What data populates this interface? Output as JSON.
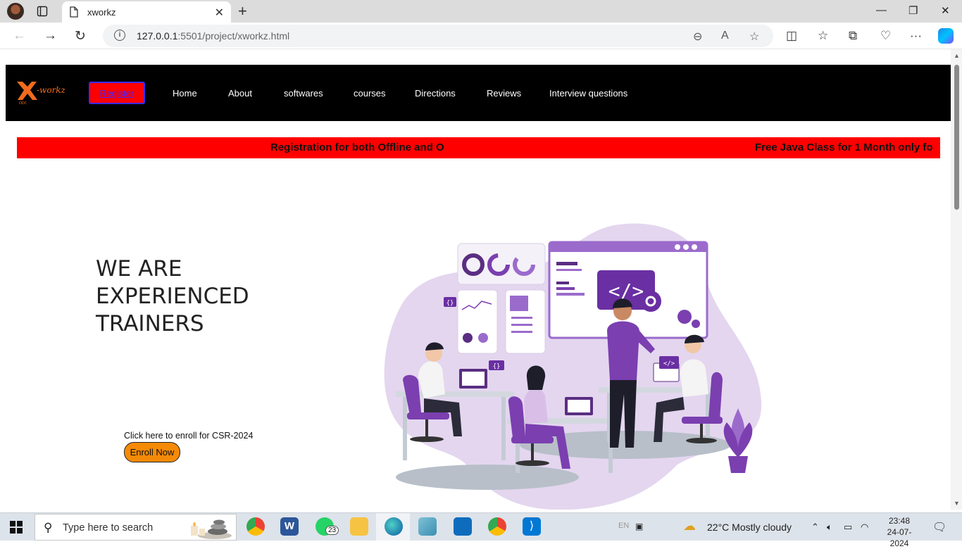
{
  "browser": {
    "tab_title": "xworkz",
    "url_host": "127.0.0.1",
    "url_rest": ":5501/project/xworkz.html"
  },
  "site": {
    "nav": {
      "register_label": "Register",
      "links": [
        "Home",
        "About",
        "softwares",
        "courses",
        "Directions",
        "Reviews",
        "Interview questions"
      ]
    },
    "marquee": {
      "item1": "Registration for both Offline and O",
      "item2": "Free Java Class for 1 Month only fo"
    },
    "hero": {
      "title_line1": "WE ARE",
      "title_line2": "EXPERIENCED",
      "title_line3": "TRAINERS",
      "enroll_text": "Click here to enroll for CSR-2024",
      "enroll_button": "Enroll Now"
    },
    "colors": {
      "nav_bg": "#000000",
      "marquee_bg": "#ff0000",
      "enroll_btn": "#f58a07",
      "accent_purple": "#7b3fb0"
    }
  },
  "taskbar": {
    "search_placeholder": "Type here to search",
    "whatsapp_badge": "23",
    "language": "EN",
    "weather": "22°C  Mostly cloudy",
    "time": "23:48",
    "date": "24-07-2024"
  }
}
